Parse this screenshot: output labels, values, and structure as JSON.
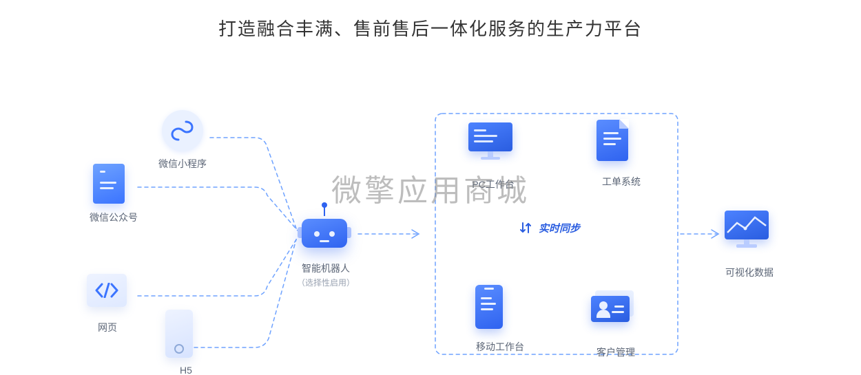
{
  "title": "打造融合丰满、售前售后一体化服务的生产力平台",
  "watermark": "微擎应用商城",
  "sync_label": "实时同步",
  "nodes": {
    "miniprogram": {
      "label": "微信小程序"
    },
    "wechat_oa": {
      "label": "微信公众号"
    },
    "web": {
      "label": "网页"
    },
    "h5": {
      "label": "H5"
    },
    "robot": {
      "label": "智能机器人",
      "sublabel": "（选择性启用）"
    },
    "pc": {
      "label": "PC工作台"
    },
    "ticket": {
      "label": "工单系统"
    },
    "mobile": {
      "label": "移动工作台"
    },
    "customer": {
      "label": "客户管理"
    },
    "chart": {
      "label": "可视化数据"
    }
  }
}
